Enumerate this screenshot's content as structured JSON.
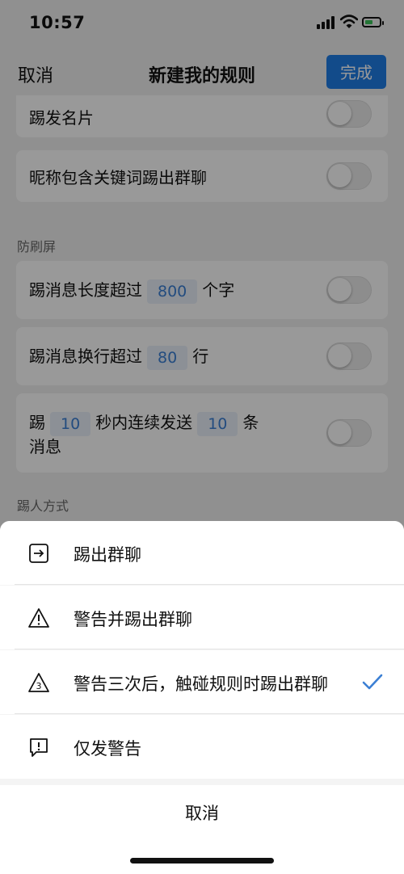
{
  "status": {
    "time": "10:57"
  },
  "nav": {
    "cancel": "取消",
    "title": "新建我的规则",
    "done": "完成"
  },
  "rules_top": [
    {
      "label": "踢发名片"
    },
    {
      "label": "昵称包含关键词踢出群聊"
    }
  ],
  "anti_spam": {
    "title": "防刷屏",
    "length": {
      "prefix": "踢消息长度超过",
      "value": "800",
      "suffix": "个字"
    },
    "lines": {
      "prefix": "踢消息换行超过",
      "value": "80",
      "suffix": "行"
    },
    "rate": {
      "prefix": "踢",
      "seconds": "10",
      "middle": "秒内连续发送",
      "count": "10",
      "suffix": "条",
      "line2": "消息"
    }
  },
  "kick_method": {
    "title": "踢人方式"
  },
  "sheet": {
    "options": [
      {
        "label": "踢出群聊",
        "icon": "exit-icon"
      },
      {
        "label": "警告并踢出群聊",
        "icon": "warning-icon"
      },
      {
        "label": "警告三次后，触碰规则时踢出群聊",
        "icon": "warning-three-icon",
        "badge": "3",
        "selected": true
      },
      {
        "label": "仅发警告",
        "icon": "message-alert-icon"
      }
    ],
    "cancel": "取消",
    "accent": "#3b7fd4"
  }
}
